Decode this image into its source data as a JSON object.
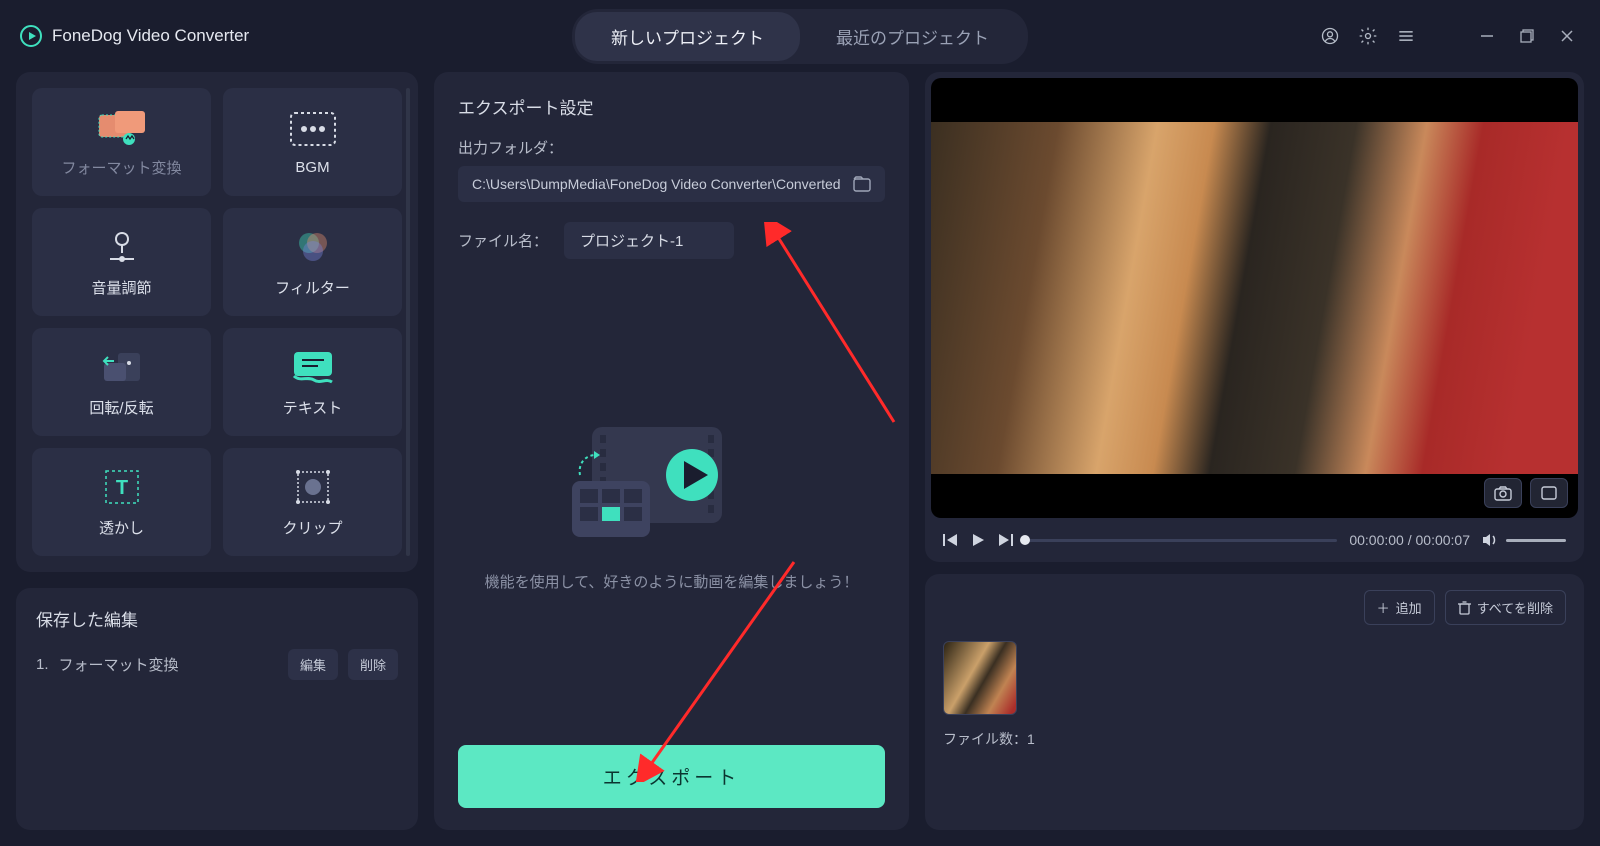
{
  "app": {
    "name": "FoneDog Video Converter"
  },
  "tabs": {
    "new_project": "新しいプロジェクト",
    "recent_project": "最近のプロジェクト"
  },
  "sidebar": {
    "tools": [
      {
        "key": "format",
        "label": "フォーマット変換",
        "muted": true
      },
      {
        "key": "bgm",
        "label": "BGM"
      },
      {
        "key": "volume",
        "label": "音量調節"
      },
      {
        "key": "filter",
        "label": "フィルター"
      },
      {
        "key": "rotate",
        "label": "回転/反転"
      },
      {
        "key": "text",
        "label": "テキスト"
      },
      {
        "key": "watermark",
        "label": "透かし"
      },
      {
        "key": "clip",
        "label": "クリップ"
      }
    ],
    "saved_title": "保存した編集",
    "saved_items": [
      {
        "idx": "1.",
        "name": "フォーマット変換"
      }
    ],
    "edit": "編集",
    "delete": "削除"
  },
  "center": {
    "section_title": "エクスポート設定",
    "output_folder_label": "出力フォルダ：",
    "output_folder_value": "C:\\Users\\DumpMedia\\FoneDog Video Converter\\Converted",
    "filename_label": "ファイル名：",
    "filename_value": "プロジェクト-1",
    "help_text": "機能を使用して、好きのように動画を編集しましょう！",
    "export_label": "エクスポート"
  },
  "player": {
    "time_current": "00:00:00",
    "time_sep": " / ",
    "time_total": "00:00:07"
  },
  "files": {
    "add": "追加",
    "delete_all": "すべてを削除",
    "count_label": "ファイル数：",
    "count_value": "1"
  }
}
